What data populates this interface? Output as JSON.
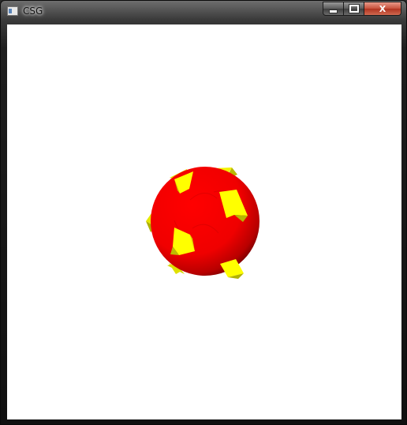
{
  "window": {
    "title": "CSG",
    "icon": "app-window-icon",
    "buttons": {
      "minimize": "minimize-icon",
      "maximize": "maximize-icon",
      "close_label": "X"
    }
  },
  "scene": {
    "sphere_color": "#ff0000",
    "polyhedron_color": "#ffff00",
    "background": "#ffffff"
  }
}
